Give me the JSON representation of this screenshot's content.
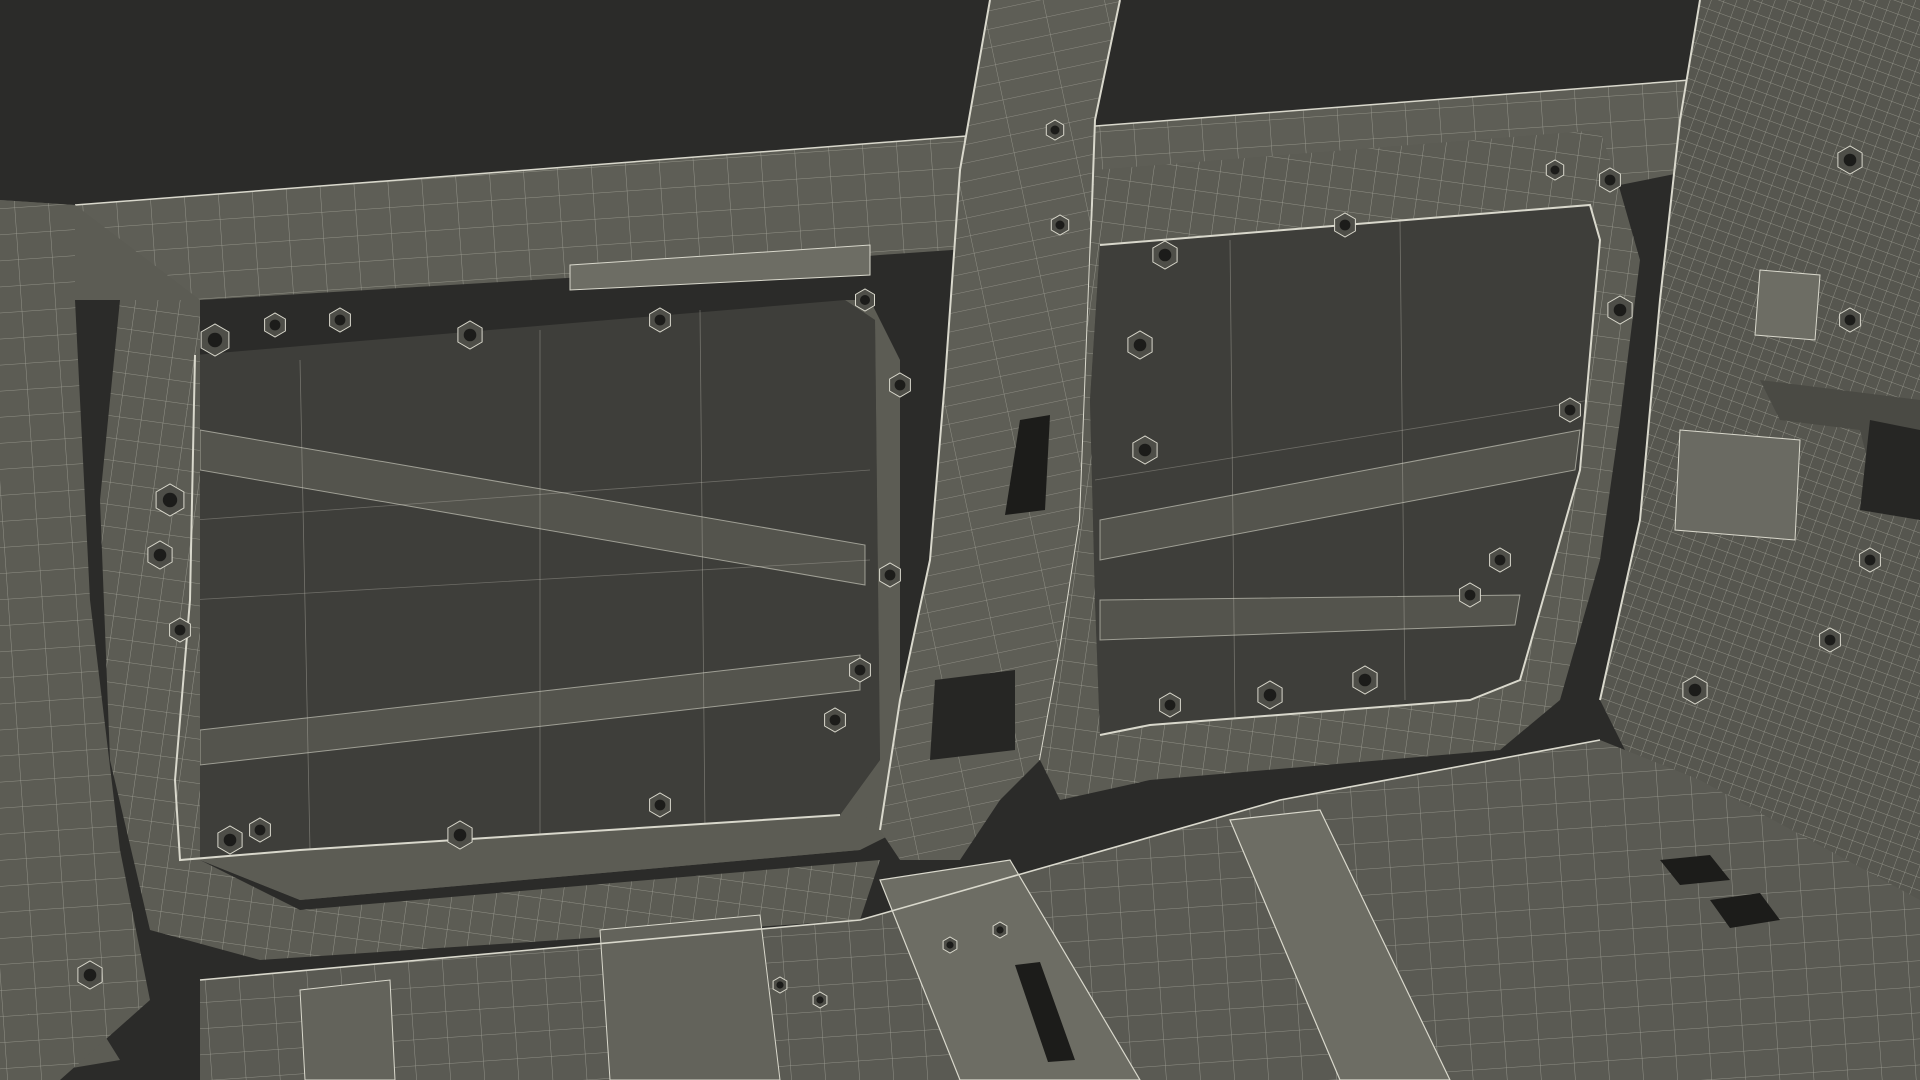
{
  "scene": {
    "subject": "wireframe-car-body-shell-interior",
    "colors": {
      "background": "#2b2b29",
      "panel": "#5c5c54",
      "panel_light": "#6d6d64",
      "panel_dark": "#45453f",
      "opening": "#3e3e3a",
      "hole": "#1c1c1a",
      "wire": "#d9d8cc"
    }
  }
}
